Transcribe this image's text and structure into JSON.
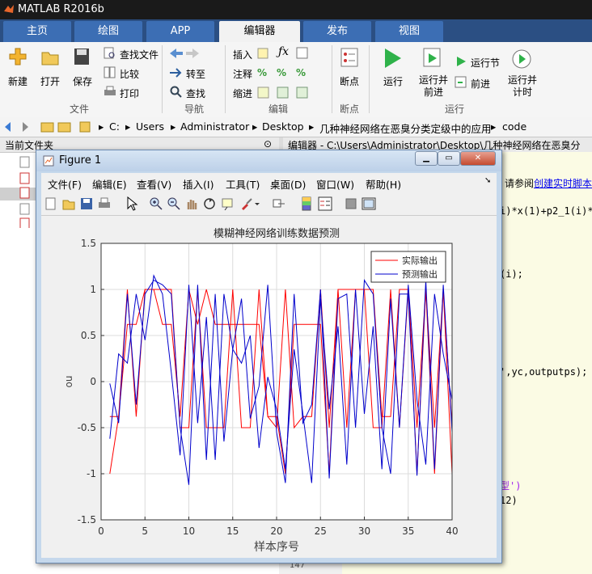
{
  "app": {
    "title": "MATLAB R2016b"
  },
  "tabs": [
    {
      "label": "主页"
    },
    {
      "label": "绘图"
    },
    {
      "label": "APP"
    },
    {
      "label": "编辑器"
    },
    {
      "label": "发布"
    },
    {
      "label": "视图"
    }
  ],
  "ribbon": {
    "file": {
      "new": "新建",
      "open": "打开",
      "save": "保存",
      "find_files": "查找文件",
      "compare": "比较",
      "print": "打印",
      "group": "文件"
    },
    "nav": {
      "goto": "转至",
      "find": "查找",
      "group": "导航"
    },
    "edit": {
      "insert": "插入",
      "comment": "注释",
      "indent": "缩进",
      "group": "编辑"
    },
    "breakpoints": {
      "label": "断点",
      "group": "断点"
    },
    "run": {
      "run": "运行",
      "run_advance": "运行并\n前进",
      "run_section": "运行节",
      "advance": "前进",
      "run_time": "运行并\n计时",
      "group": "运行"
    }
  },
  "address": {
    "segments": [
      "C:",
      "Users",
      "Administrator",
      "Desktop",
      "几种神经网络在恶臭分类定级中的应用",
      "code"
    ]
  },
  "current_folder": {
    "title": "当前文件夹"
  },
  "editor": {
    "title": "编辑器 - C:\\Users\\Administrator\\Desktop\\几种神经网络在恶臭分",
    "hint_text": "，请参阅",
    "hint_link": "创建实时脚本",
    "lines": [
      "i)*x(1)+p2_1(i)*x",
      "(i);",
      "',yc,outputps);",
      "型')",
      "12)"
    ],
    "line_number": "147"
  },
  "figure": {
    "title": "Figure 1",
    "menu": [
      "文件(F)",
      "编辑(E)",
      "查看(V)",
      "插入(I)",
      "工具(T)",
      "桌面(D)",
      "窗口(W)",
      "帮助(H)"
    ],
    "menu_arrow": "➘"
  },
  "chart_data": {
    "type": "line",
    "title": "模糊神经网络训练数据预测",
    "xlabel": "样本序号",
    "ylabel": "ou",
    "xlim": [
      0,
      40
    ],
    "ylim": [
      -1.5,
      1.5
    ],
    "xticks": [
      0,
      5,
      10,
      15,
      20,
      25,
      30,
      35,
      40
    ],
    "yticks": [
      -1.5,
      -1,
      -0.5,
      0,
      0.5,
      1,
      1.5
    ],
    "grid": true,
    "legend_position": "top-right",
    "series": [
      {
        "name": "实际输出",
        "color": "#ff0000",
        "x": [
          1,
          2,
          3,
          4,
          5,
          6,
          7,
          8,
          9,
          10,
          11,
          12,
          13,
          14,
          15,
          16,
          17,
          18,
          19,
          20,
          21,
          22,
          23,
          24,
          25,
          26,
          27,
          28,
          29,
          30,
          31,
          32,
          33,
          34,
          35,
          36,
          37,
          38,
          39,
          40
        ],
        "lines": [
          [
            -1,
            -0.38,
            0.62,
            0.62,
            1,
            1,
            0.62,
            0.62,
            -0.38,
            1,
            0.62,
            1,
            0.62,
            0.62,
            0.62,
            0.62,
            0.62,
            0.62,
            -0.38,
            -0.38,
            -1,
            0.62,
            0.62,
            0.62,
            0.62,
            -1,
            1,
            1,
            1,
            1,
            1,
            -0.38,
            -0.38,
            1,
            1,
            -1,
            1,
            -1,
            1,
            -1
          ],
          [
            -0.38,
            -0.38,
            1,
            -0.38,
            1,
            1,
            1,
            1,
            -0.5,
            -0.5,
            1,
            -0.5,
            -0.5,
            -0.5,
            1,
            -0.5,
            -0.5,
            1,
            -0.38,
            -0.5,
            1,
            -0.5,
            -0.38,
            -0.38,
            1,
            -0.5,
            1,
            -0.5,
            1,
            1,
            -0.5,
            -0.5,
            1,
            -0.5,
            1,
            -0.5,
            1,
            -0.5,
            1,
            -0.5
          ]
        ]
      },
      {
        "name": "预测输出",
        "color": "#0000cc",
        "x": [
          1,
          2,
          3,
          4,
          5,
          6,
          7,
          8,
          9,
          10,
          11,
          12,
          13,
          14,
          15,
          16,
          17,
          18,
          19,
          20,
          21,
          22,
          23,
          24,
          25,
          26,
          27,
          28,
          29,
          30,
          31,
          32,
          33,
          34,
          35,
          36,
          37,
          38,
          39,
          40
        ],
        "lines": [
          [
            -0.02,
            -0.45,
            0.95,
            -0.25,
            0.95,
            1.1,
            1.05,
            0.95,
            -0.5,
            -1.12,
            1.05,
            -0.85,
            0.95,
            -0.65,
            0.35,
            0.9,
            -0.4,
            -0.05,
            1.05,
            -0.55,
            -1.1,
            0.95,
            -0.45,
            -0.25,
            1.0,
            -1.05,
            0.9,
            0.95,
            -0.5,
            1.1,
            0.95,
            -0.5,
            -1.0,
            0.95,
            0.95,
            -1.02,
            1.1,
            -0.95,
            1.05,
            -0.55
          ],
          [
            -0.62,
            0.3,
            0.2,
            0.95,
            0.45,
            1.15,
            0.95,
            0.1,
            -0.8,
            1.05,
            -0.45,
            0.7,
            -0.85,
            0.95,
            0.35,
            0.2,
            0.5,
            -0.72,
            0.05,
            -0.3,
            -0.95,
            0.35,
            -0.35,
            -1.1,
            0.9,
            -0.3,
            0.6,
            -0.9,
            1.0,
            -0.35,
            0.6,
            -0.95,
            0.9,
            -0.5,
            1.05,
            -0.2,
            -0.9,
            0.95,
            0.3,
            -0.2
          ]
        ]
      }
    ]
  }
}
